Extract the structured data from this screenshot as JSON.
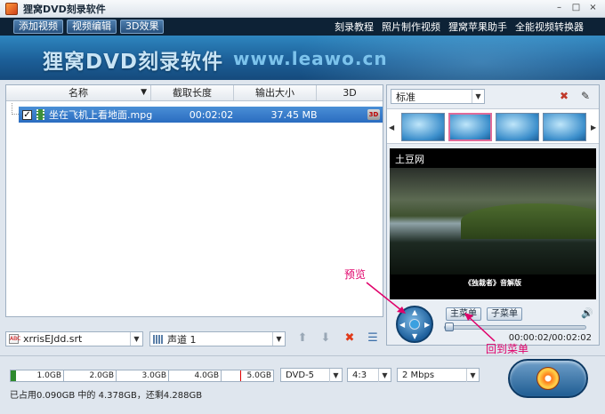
{
  "window": {
    "title": "狸窝DVD刻录软件",
    "min": "–",
    "max": "□",
    "close": "×"
  },
  "toolbar": {
    "buttons": [
      "添加视频",
      "视频编辑",
      "3D效果"
    ],
    "links": [
      "刻录教程",
      "照片制作视频",
      "狸窝苹果助手",
      "全能视频转换器"
    ]
  },
  "banner": {
    "title": "狸窝DVD刻录软件",
    "url": "www.leawo.cn"
  },
  "file_table": {
    "columns": [
      "名称",
      "截取长度",
      "输出大小",
      "3D"
    ],
    "rows": [
      {
        "checked": "✓",
        "name": "坐在飞机上看地面.mpg",
        "duration": "00:02:02",
        "size": "37.45 MB",
        "badge": "3D"
      }
    ]
  },
  "bottom_left": {
    "subtitle_value": "xrrisEJdd.srt",
    "audio_value": "声道 1",
    "arrow": "▼"
  },
  "preview": {
    "template_value": "标准",
    "video_label": "土豆网",
    "video_caption": "《独裁者》音解版",
    "main_menu_label": "主菜单",
    "sub_menu_label": "子菜单",
    "time": "00:00:02/00:02:02",
    "progress": 0.0
  },
  "annotations": {
    "preview": "预览",
    "back_to_menu": "回到菜单"
  },
  "capacity": {
    "used_fraction": 0.02,
    "ticks": [
      "1.0GB",
      "2.0GB",
      "3.0GB",
      "4.0GB",
      "5.0GB"
    ],
    "limit_gb": 4.378,
    "status": "已占用0.090GB 中的 4.378GB，还剩4.288GB"
  },
  "output": {
    "disc_type": "DVD-5",
    "aspect": "4:3",
    "bitrate": "2 Mbps"
  },
  "colors": {
    "annotation": "#e0006a",
    "selection": "#2a6cc0",
    "capacity_fill": "#2e8a2e",
    "limit_line": "#e00000"
  }
}
